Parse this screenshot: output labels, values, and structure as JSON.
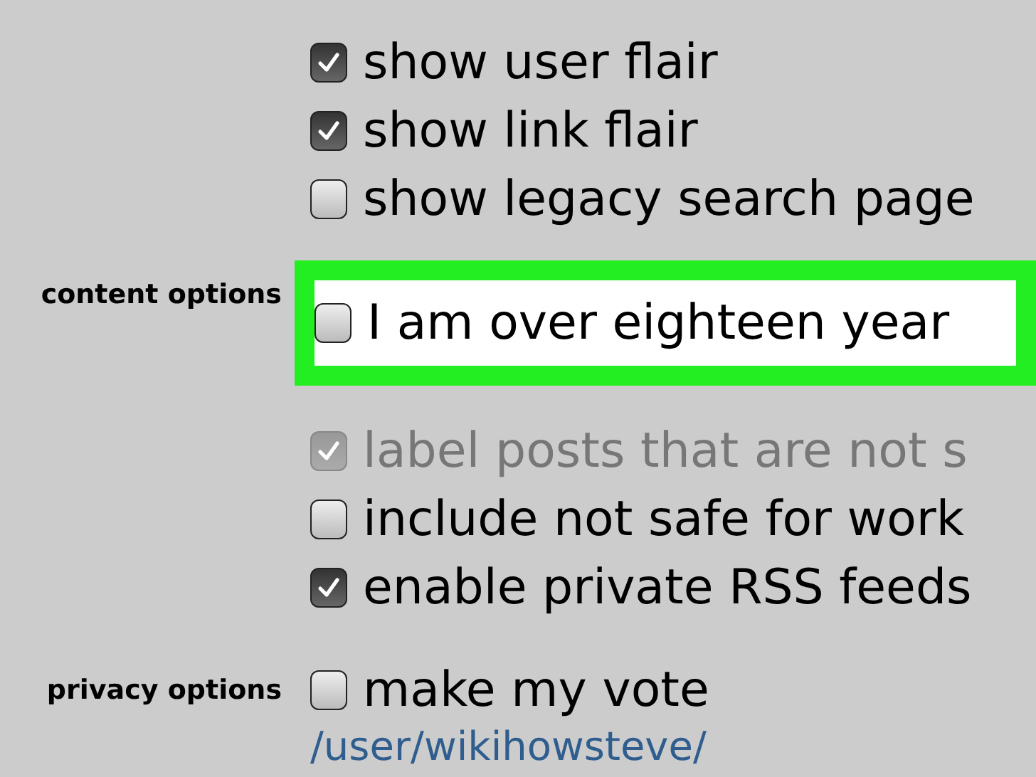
{
  "sections": [
    {
      "rows": [
        {
          "kind": "option",
          "text": "show user flair",
          "checked": true,
          "disabled": false,
          "highlighted": false
        },
        {
          "kind": "option",
          "text": "show link flair",
          "checked": true,
          "disabled": false,
          "highlighted": false
        },
        {
          "kind": "option",
          "text": "show legacy search page",
          "checked": false,
          "disabled": false,
          "highlighted": false
        }
      ]
    },
    {
      "label": "content options",
      "rows": [
        {
          "kind": "option",
          "text": "I am over eighteen year",
          "checked": false,
          "disabled": false,
          "highlighted": true
        },
        {
          "kind": "option",
          "text": "label posts that are not s",
          "checked": true,
          "disabled": true,
          "highlighted": false
        },
        {
          "kind": "option",
          "text": "include not safe for work",
          "checked": false,
          "disabled": false,
          "highlighted": false
        },
        {
          "kind": "option",
          "text": "enable private RSS feeds",
          "checked": true,
          "disabled": false,
          "highlighted": false
        }
      ]
    },
    {
      "label": "privacy options",
      "rows": [
        {
          "kind": "option",
          "text": "make my vote",
          "checked": false,
          "disabled": false,
          "highlighted": false
        },
        {
          "kind": "link",
          "text": "/user/wikihowsteve/"
        }
      ]
    }
  ]
}
